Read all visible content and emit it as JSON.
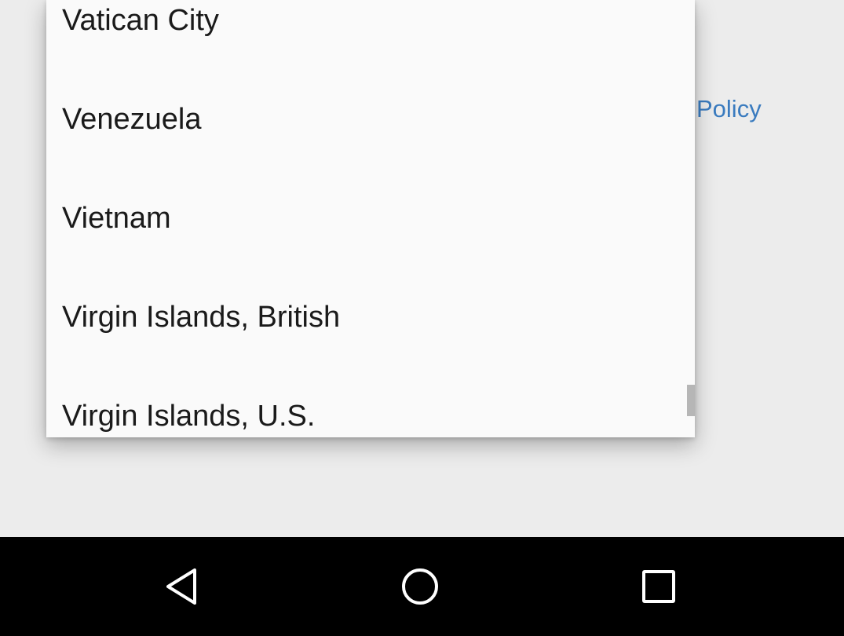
{
  "background": {
    "link_text": "Policy",
    "link_color": "#3a7bbf"
  },
  "country_dropdown": {
    "items": [
      {
        "label": "Vatican City"
      },
      {
        "label": "Venezuela"
      },
      {
        "label": "Vietnam"
      },
      {
        "label": "Virgin Islands, British"
      },
      {
        "label": "Virgin Islands, U.S."
      }
    ]
  },
  "nav_bar": {
    "back_icon": "triangle-back-icon",
    "home_icon": "circle-home-icon",
    "recents_icon": "square-recents-icon"
  }
}
